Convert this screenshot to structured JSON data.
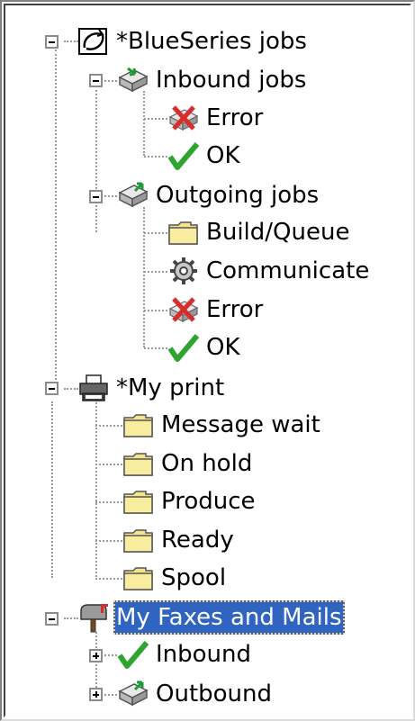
{
  "tree": {
    "blueseries": {
      "label": "*BlueSeries jobs",
      "icon": "blueseries-icon"
    },
    "inbound_jobs": {
      "label": "Inbound jobs",
      "icon": "inbound-tray-icon"
    },
    "inbound_error": {
      "label": "Error",
      "icon": "error-x-icon"
    },
    "inbound_ok": {
      "label": "OK",
      "icon": "checkmark-icon"
    },
    "outgoing_jobs": {
      "label": "Outgoing jobs",
      "icon": "outbound-tray-icon"
    },
    "build_queue": {
      "label": "Build/Queue",
      "icon": "folder-icon"
    },
    "communicate": {
      "label": "Communicate",
      "icon": "gear-icon"
    },
    "outgoing_error": {
      "label": "Error",
      "icon": "error-x-icon"
    },
    "outgoing_ok": {
      "label": "OK",
      "icon": "checkmark-icon"
    },
    "my_print": {
      "label": "*My print",
      "icon": "printer-icon"
    },
    "message_wait": {
      "label": "Message wait",
      "icon": "folder-icon"
    },
    "on_hold": {
      "label": "On hold",
      "icon": "folder-icon"
    },
    "produce": {
      "label": "Produce",
      "icon": "folder-icon"
    },
    "ready": {
      "label": "Ready",
      "icon": "folder-icon"
    },
    "spool": {
      "label": "Spool",
      "icon": "folder-icon"
    },
    "faxes_mails": {
      "label": "My Faxes and Mails",
      "icon": "mailbox-icon",
      "selected": true
    },
    "fm_inbound": {
      "label": "Inbound",
      "icon": "checkmark-icon"
    },
    "fm_outbound": {
      "label": "Outbound",
      "icon": "outbound-tray-icon"
    }
  },
  "colors": {
    "selection": "#2f64c0",
    "folder": "#f5e58a",
    "check": "#2fa52f",
    "error": "#d62d2d"
  }
}
